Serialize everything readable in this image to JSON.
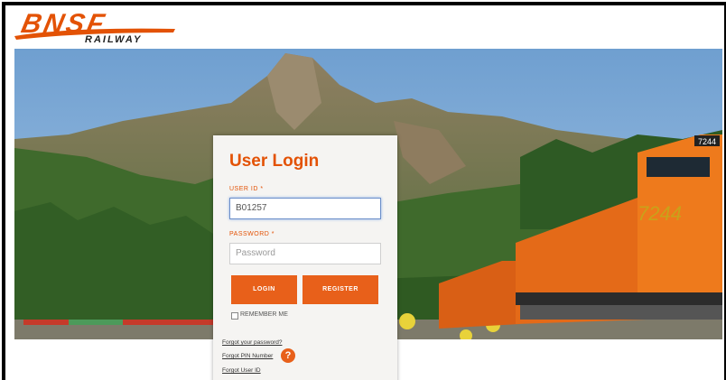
{
  "brand": {
    "name": "BNSF",
    "subtitle": "RAILWAY",
    "color": "#e35205"
  },
  "hero": {
    "train_number": "7244"
  },
  "login": {
    "title": "User Login",
    "user_id_label": "USER ID",
    "user_id_value": "B01257",
    "password_label": "PASSWORD",
    "password_placeholder": "Password",
    "required_mark": "*",
    "login_button": "LOGIN",
    "register_button": "REGISTER",
    "remember_me": "REMEMBER ME",
    "links": {
      "forgot_password": "Forgot your password?",
      "forgot_pin": "Forgot PIN Number",
      "forgot_user_id": "Forgot User ID"
    },
    "help_icon": "question-icon",
    "accent": "#e8601a"
  }
}
